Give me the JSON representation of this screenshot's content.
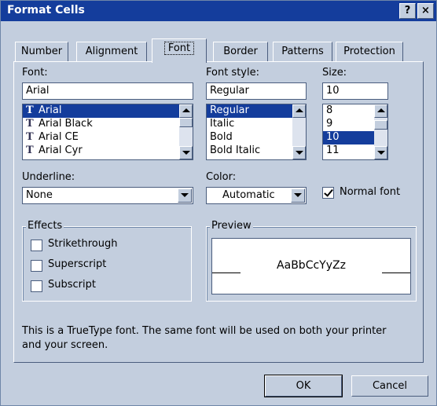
{
  "window": {
    "title": "Format Cells",
    "help_label": "?",
    "close_label": "×"
  },
  "tabs": [
    {
      "label": "Number"
    },
    {
      "label": "Alignment"
    },
    {
      "label": "Font"
    },
    {
      "label": "Border"
    },
    {
      "label": "Patterns"
    },
    {
      "label": "Protection"
    }
  ],
  "active_tab": "Font",
  "font": {
    "label": "Font:",
    "value": "Arial",
    "items": [
      "Arial",
      "Arial Black",
      "Arial CE",
      "Arial Cyr"
    ],
    "selected": "Arial"
  },
  "font_style": {
    "label": "Font style:",
    "value": "Regular",
    "items": [
      "Regular",
      "Italic",
      "Bold",
      "Bold Italic"
    ],
    "selected": "Regular"
  },
  "size": {
    "label": "Size:",
    "value": "10",
    "items": [
      "8",
      "9",
      "10",
      "11"
    ],
    "selected": "10"
  },
  "underline": {
    "label": "Underline:",
    "value": "None"
  },
  "color": {
    "label": "Color:",
    "value": "Automatic"
  },
  "normal_font": {
    "label": "Normal font",
    "checked": true
  },
  "effects": {
    "title": "Effects",
    "strikethrough": "Strikethrough",
    "superscript": "Superscript",
    "subscript": "Subscript"
  },
  "preview": {
    "title": "Preview",
    "sample": "AaBbCcYyZz"
  },
  "description": {
    "line1": "This is a TrueType font.  The same font will be used on both your printer",
    "line2": "and your screen."
  },
  "buttons": {
    "ok": "OK",
    "cancel": "Cancel"
  },
  "colors": {
    "titlebar": "#143d9c",
    "dialog_bg": "#c3cede",
    "selection": "#143d9c"
  }
}
